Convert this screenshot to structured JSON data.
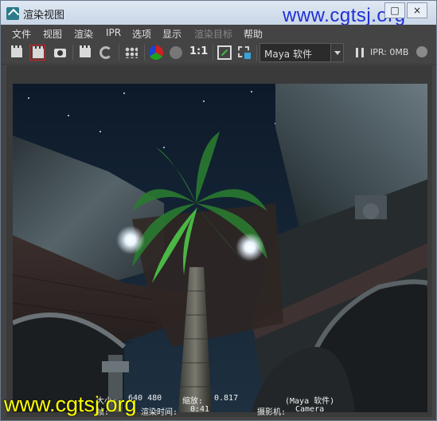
{
  "window": {
    "title": "渲染视图"
  },
  "watermark": {
    "top": "www.cgtsj.org",
    "bottom": "www.cgtsj.org"
  },
  "menu": [
    {
      "label": "文件",
      "enabled": true
    },
    {
      "label": "视图",
      "enabled": true
    },
    {
      "label": "渲染",
      "enabled": true
    },
    {
      "label": "IPR",
      "enabled": true
    },
    {
      "label": "选项",
      "enabled": true
    },
    {
      "label": "显示",
      "enabled": true
    },
    {
      "label": "渲染目标",
      "enabled": false
    },
    {
      "label": "帮助",
      "enabled": true
    }
  ],
  "toolbar": {
    "one_to_one": "1:1",
    "renderer": "Maya 软件",
    "ipr_status": "IPR: 0MB"
  },
  "render_info": {
    "size_label": "大小:",
    "size": "640 480",
    "zoom_label": "缩放:",
    "zoom": "0.817",
    "renderer": "(Maya 软件)",
    "frame_label": "帧:",
    "time_label": "渲染时间:",
    "time": "0:41",
    "camera_label": "摄影机:",
    "camera": "Camera"
  }
}
